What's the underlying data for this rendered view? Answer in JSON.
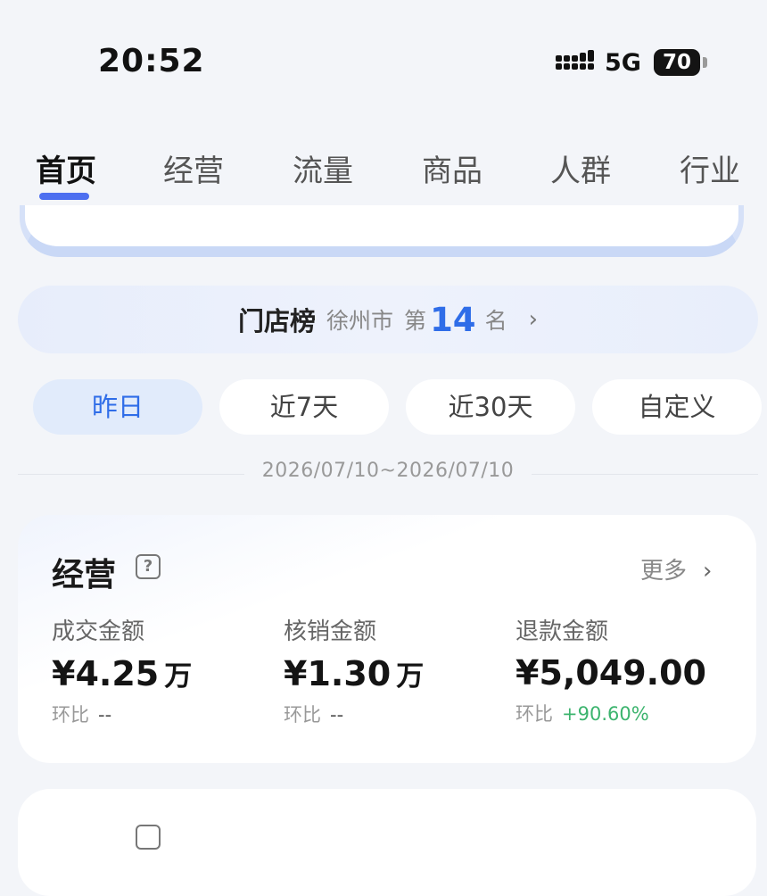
{
  "status_bar": {
    "time": "20:52",
    "network": "5G",
    "battery": "70"
  },
  "tabs": [
    {
      "label": "首页",
      "active": true
    },
    {
      "label": "经营",
      "active": false
    },
    {
      "label": "流量",
      "active": false
    },
    {
      "label": "商品",
      "active": false
    },
    {
      "label": "人群",
      "active": false
    },
    {
      "label": "行业",
      "active": false
    }
  ],
  "rank_banner": {
    "title": "门店榜",
    "city": "徐州市",
    "prefix": "第",
    "rank": "14",
    "suffix": "名",
    "arrow": "›"
  },
  "date_filters": [
    {
      "label": "昨日",
      "selected": true
    },
    {
      "label": "近7天",
      "selected": false
    },
    {
      "label": "近30天",
      "selected": false
    },
    {
      "label": "自定义",
      "selected": false
    }
  ],
  "date_range": "2026/07/10~2026/07/10",
  "business": {
    "title": "经营",
    "help": "?",
    "more": "更多",
    "more_chevron": "›",
    "metrics": [
      {
        "label": "成交金额",
        "value": "¥4.25",
        "unit": "万",
        "compare_label": "环比",
        "compare_value": "--"
      },
      {
        "label": "核销金额",
        "value": "¥1.30",
        "unit": "万",
        "compare_label": "环比",
        "compare_value": "--"
      },
      {
        "label": "退款金额",
        "value": "¥5,049.00",
        "unit": "",
        "compare_label": "环比",
        "compare_value": "+90.60%"
      }
    ]
  },
  "colors": {
    "accent": "#2f6de8",
    "tab_indicator": "#4d6ff0",
    "positive": "#3cb46e",
    "pill_selected_bg": "#e1ebfb"
  }
}
